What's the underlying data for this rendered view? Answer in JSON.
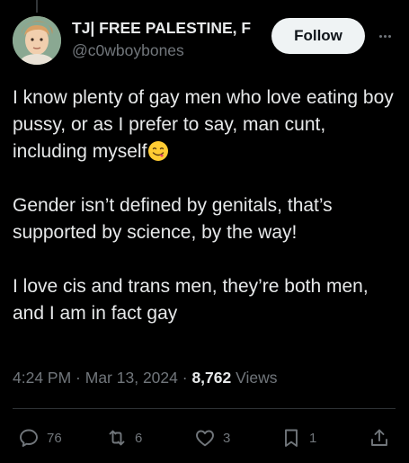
{
  "author": {
    "display_name": "TJ| FREE PALESTINE, F",
    "handle": "@c0wboybones"
  },
  "follow_label": "Follow",
  "post": {
    "paragraphs": [
      "I know plenty of gay men who love eating boy pussy, or as I prefer to say, man cunt, including myself",
      "Gender isn’t defined by genitals, that’s supported by science, by the way!",
      "I love cis and trans men, they’re both men, and I am in fact gay"
    ],
    "emoji": "face-savoring-food"
  },
  "meta": {
    "time": "4:24 PM",
    "separator1": " · ",
    "date": "Mar 13, 2024",
    "separator2": " · ",
    "views_count": "8,762",
    "views_label": " Views"
  },
  "actions": {
    "replies": "76",
    "reposts": "6",
    "likes": "3",
    "bookmarks": "1"
  },
  "icons": [
    "reply-icon",
    "repost-icon",
    "like-icon",
    "bookmark-icon",
    "share-icon",
    "more-icon"
  ],
  "colors": {
    "background": "#000000",
    "text": "#e7e9ea",
    "secondary": "#71767b",
    "follow_bg": "#eff3f4"
  }
}
